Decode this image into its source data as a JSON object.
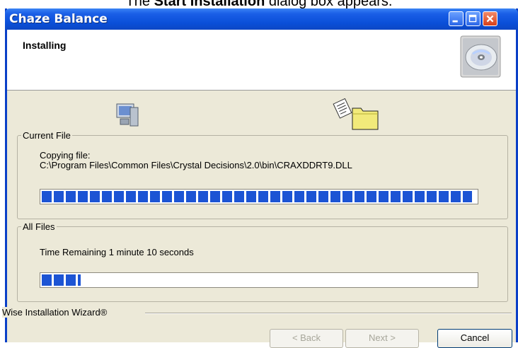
{
  "doc_caption": {
    "prefix": "The ",
    "bold": "Start Installation",
    "suffix": " dialog box appears."
  },
  "window": {
    "title": "Chaze Balance"
  },
  "header": {
    "title": "Installing"
  },
  "current_file": {
    "legend": "Current File",
    "copy_label": "Copying file:",
    "path": "C:\\Program Files\\Common Files\\Crystal Decisions\\2.0\\bin\\CRAXDDRT9.DLL",
    "progress_fraction": 0.99
  },
  "all_files": {
    "legend": "All Files",
    "time_remaining": "Time Remaining 1 minute  10 seconds",
    "progress_fraction": 0.09
  },
  "footer": {
    "wizard_label": "Wise Installation Wizard®"
  },
  "buttons": {
    "back": "< Back",
    "next": "Next >",
    "cancel": "Cancel"
  },
  "colors": {
    "title_bar": "#0a4fd8",
    "progress_block": "#1c54d4",
    "dialog_bg": "#ece9d8"
  },
  "icons": [
    "minimize-icon",
    "maximize-icon",
    "close-icon",
    "cd-disc-icon",
    "computer-icon",
    "folder-with-document-icon"
  ]
}
